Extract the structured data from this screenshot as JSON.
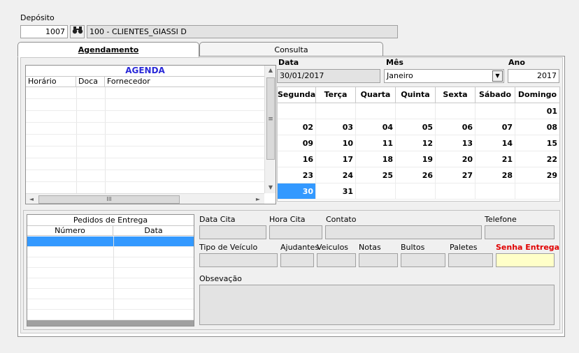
{
  "deposito": {
    "label": "Depósito",
    "code": "1007",
    "name": "100 - CLIENTES_GIASSI D"
  },
  "tabs": [
    {
      "label": "Agendamento",
      "active": true
    },
    {
      "label": "Consulta",
      "active": false
    }
  ],
  "agenda": {
    "title": "AGENDA",
    "columns": [
      "Horário",
      "Doca",
      "Fornecedor"
    ],
    "scroll_h_label": "III",
    "scroll_v_grip": "≡"
  },
  "date_panel": {
    "data_label": "Data",
    "data_value": "30/01/2017",
    "mes_label": "Mês",
    "mes_value": "Janeiro",
    "ano_label": "Ano",
    "ano_value": "2017"
  },
  "calendar": {
    "weekdays": [
      "Segunda",
      "Terça",
      "Quarta",
      "Quinta",
      "Sexta",
      "Sábado",
      "Domingo"
    ],
    "weeks": [
      [
        "",
        "",
        "",
        "",
        "",
        "",
        "01"
      ],
      [
        "02",
        "03",
        "04",
        "05",
        "06",
        "07",
        "08"
      ],
      [
        "09",
        "10",
        "11",
        "12",
        "13",
        "14",
        "15"
      ],
      [
        "16",
        "17",
        "18",
        "19",
        "20",
        "21",
        "22"
      ],
      [
        "23",
        "24",
        "25",
        "26",
        "27",
        "28",
        "29"
      ],
      [
        "30",
        "31",
        "",
        "",
        "",
        "",
        ""
      ]
    ],
    "selected_day": "30"
  },
  "pedidos": {
    "title": "Pedidos de Entrega",
    "columns": [
      "Número",
      "Data"
    ]
  },
  "details": {
    "data_cita": "Data Cita",
    "hora_cita": "Hora Cita",
    "contato": "Contato",
    "telefone": "Telefone",
    "tipo_veiculo": "Tipo de Veículo",
    "ajudantes": "Ajudantes",
    "veiculos": "Veiculos",
    "notas": "Notas",
    "bultos": "Bultos",
    "paletes": "Paletes",
    "senha_entrega": "Senha Entrega",
    "observacao": "Obsevação"
  },
  "colors": {
    "accent_blue": "#3399ff",
    "agenda_title": "#2a2ad8",
    "senha_red": "#e00000",
    "senha_field": "#ffffc8"
  }
}
